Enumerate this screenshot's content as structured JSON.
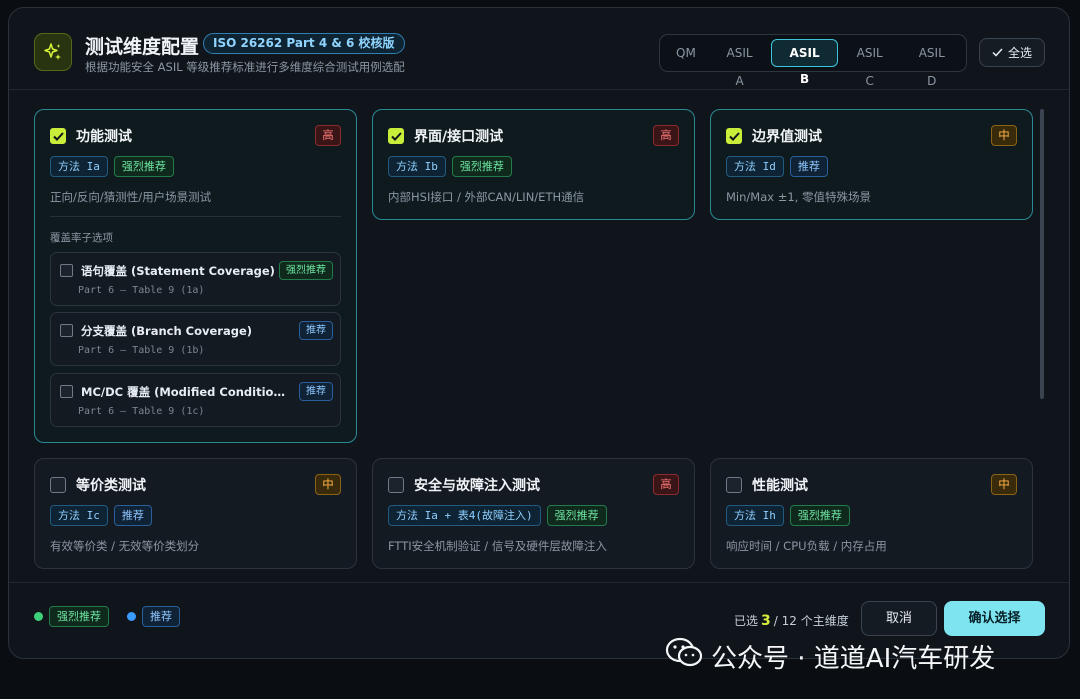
{
  "header": {
    "title": "测试维度配置",
    "standard_badge": "ISO 26262 Part 4 & 6 校核版",
    "subtitle": "根据功能安全 ASIL 等级推荐标准进行多维度综合测试用例选配",
    "asil_levels": [
      "QM",
      "ASIL A",
      "ASIL B",
      "ASIL C",
      "ASIL D"
    ],
    "asil_selected": "ASIL B",
    "select_all": "全选"
  },
  "cards": [
    {
      "title": "功能测试",
      "checked": true,
      "level": "高",
      "tags": [
        {
          "text": "方法 Ia",
          "kind": "method"
        },
        {
          "text": "强烈推荐",
          "kind": "strong"
        }
      ],
      "desc": "正向/反向/猜测性/用户场景测试",
      "coverage_label": "覆盖率子选项",
      "coverage": [
        {
          "title": "语句覆盖 (Statement Coverage)",
          "ref": "Part 6 — Table 9 (1a)",
          "tag": "强烈推荐",
          "kind": "strong"
        },
        {
          "title": "分支覆盖 (Branch Coverage)",
          "ref": "Part 6 — Table 9 (1b)",
          "tag": "推荐",
          "kind": "rec"
        },
        {
          "title": "MC/DC 覆盖 (Modified Condition/De...",
          "ref": "Part 6 — Table 9 (1c)",
          "tag": "推荐",
          "kind": "rec"
        }
      ]
    },
    {
      "title": "界面/接口测试",
      "checked": true,
      "level": "高",
      "tags": [
        {
          "text": "方法 Ib",
          "kind": "method"
        },
        {
          "text": "强烈推荐",
          "kind": "strong"
        }
      ],
      "desc": "内部HSI接口 / 外部CAN/LIN/ETH通信"
    },
    {
      "title": "边界值测试",
      "checked": true,
      "level": "中",
      "tags": [
        {
          "text": "方法 Id",
          "kind": "method"
        },
        {
          "text": "推荐",
          "kind": "rec"
        }
      ],
      "desc": "Min/Max ±1, 零值特殊场景"
    },
    {
      "title": "等价类测试",
      "checked": false,
      "level": "中",
      "tags": [
        {
          "text": "方法 Ic",
          "kind": "method"
        },
        {
          "text": "推荐",
          "kind": "rec"
        }
      ],
      "desc": "有效等价类 / 无效等价类划分"
    },
    {
      "title": "安全与故障注入测试",
      "checked": false,
      "level": "高",
      "tags": [
        {
          "text": "方法 Ia + 表4(故障注入)",
          "kind": "method"
        },
        {
          "text": "强烈推荐",
          "kind": "strong"
        }
      ],
      "desc": "FTTI安全机制验证 / 信号及硬件层故障注入"
    },
    {
      "title": "性能测试",
      "checked": false,
      "level": "中",
      "tags": [
        {
          "text": "方法 Ih",
          "kind": "method"
        },
        {
          "text": "强烈推荐",
          "kind": "strong"
        }
      ],
      "desc": "响应时间 / CPU负载 / 内存占用"
    }
  ],
  "footer": {
    "legend": [
      {
        "text": "强烈推荐",
        "color": "#3ecf7a"
      },
      {
        "text": "推荐",
        "color": "#3a9bff"
      }
    ],
    "selected_prefix": "已选",
    "selected_count": "3",
    "selected_suffix": "/ 12 个主维度",
    "cancel": "取消",
    "confirm": "确认选择"
  },
  "watermark": "公众号 · 道道AI汽车研发",
  "colors": {
    "accent": "#7de4f0",
    "check": "#c8ee3a",
    "high": "#ff7b7b",
    "mid": "#ffb547"
  }
}
